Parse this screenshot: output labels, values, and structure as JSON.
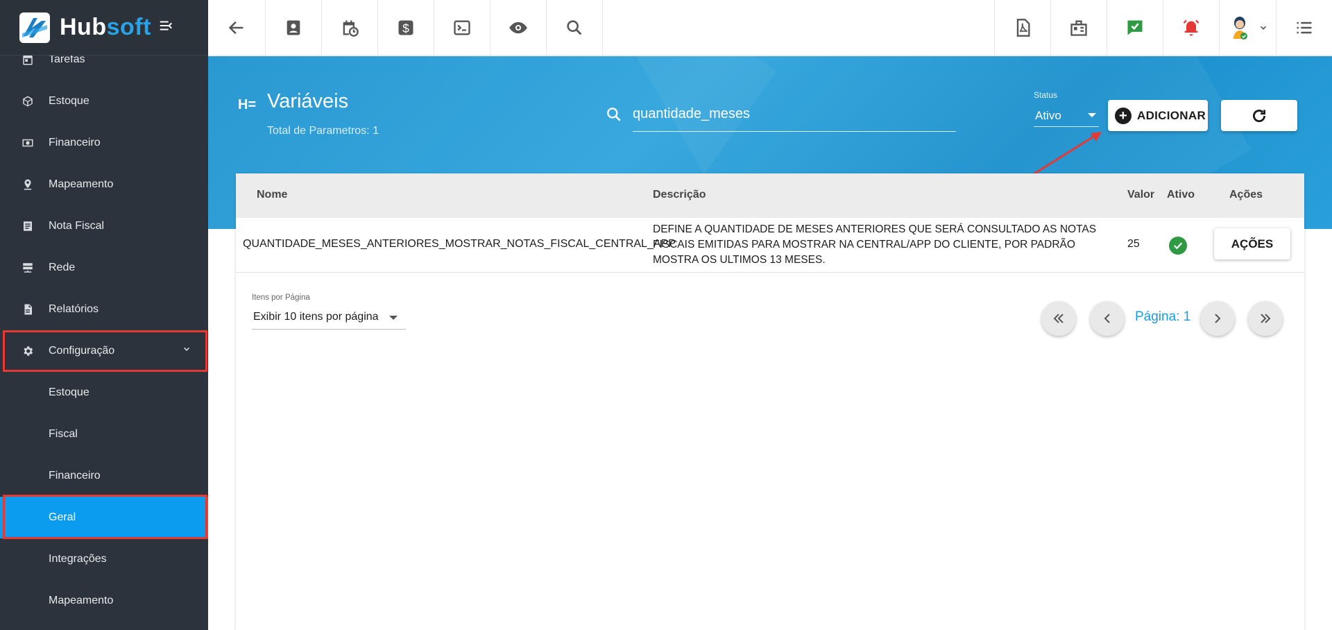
{
  "app": {
    "logo_hub": "Hub",
    "logo_soft": "soft"
  },
  "sidebar": {
    "items": [
      {
        "label": "Tarefas",
        "icon": "calendar-icon"
      },
      {
        "label": "Estoque",
        "icon": "box-icon"
      },
      {
        "label": "Financeiro",
        "icon": "money-icon"
      },
      {
        "label": "Mapeamento",
        "icon": "map-pin-icon"
      },
      {
        "label": "Nota Fiscal",
        "icon": "document-icon"
      },
      {
        "label": "Rede",
        "icon": "network-icon"
      },
      {
        "label": "Relatórios",
        "icon": "report-icon"
      },
      {
        "label": "Configuração",
        "icon": "gear-icon"
      }
    ],
    "sub_items": [
      {
        "label": "Estoque"
      },
      {
        "label": "Fiscal"
      },
      {
        "label": "Financeiro"
      },
      {
        "label": "Geral"
      },
      {
        "label": "Integrações"
      },
      {
        "label": "Mapeamento"
      }
    ],
    "active_sub_item": "Geral",
    "colors": {
      "background": "#2c333c",
      "active": "#0b9cf0",
      "highlight": "#e53935"
    }
  },
  "topbar": {
    "buttons": [
      "back-icon",
      "contact-icon",
      "calendar-clock-icon",
      "dollar-icon",
      "terminal-icon",
      "eye-icon",
      "search-icon",
      "pdf-icon",
      "building-icon",
      "chat-check-icon",
      "alarm-icon",
      "user-avatar",
      "menu-list-icon"
    ]
  },
  "header": {
    "title": "Variáveis",
    "title_icon": "H=",
    "subtitle": "Total de Parametros: 1",
    "search_value": "quantidade_meses",
    "status_label": "Status",
    "status_value": "Ativo",
    "add_label": "ADICIONAR",
    "band_color": "#2a9fd8"
  },
  "table": {
    "columns": [
      "Nome",
      "Descrição",
      "Valor",
      "Ativo",
      "Ações"
    ],
    "rows": [
      {
        "nome": "QUANTIDADE_MESES_ANTERIORES_MOSTRAR_NOTAS_FISCAL_CENTRAL_APP",
        "descricao": "DEFINE A QUANTIDADE DE MESES ANTERIORES QUE SERÁ CONSULTADO AS NOTAS FISCAIS EMITIDAS PARA MOSTRAR NA CENTRAL/APP DO CLIENTE, POR PADRÃO MOSTRA OS ULTIMOS 13 MESES.",
        "valor": "25",
        "ativo": true,
        "acoes_label": "AÇÕES"
      }
    ]
  },
  "pagination": {
    "per_page_label": "Itens por Página",
    "per_page_value": "Exibir 10 itens por página",
    "page_label": "Página: 1"
  }
}
